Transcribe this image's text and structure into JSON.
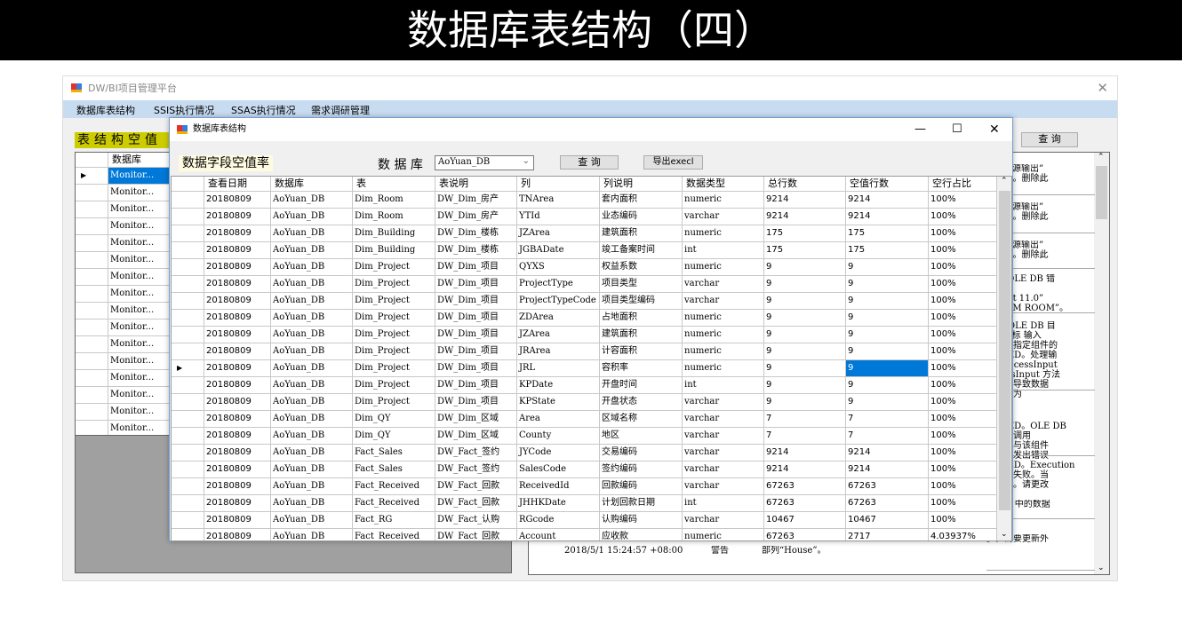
{
  "banner": {
    "title": "数据库表结构（四）"
  },
  "main_window": {
    "title": "DW/BI项目管理平台",
    "close_icon": "close-icon",
    "menu": [
      "数据库表结构",
      "SSIS执行情况",
      "SSAS执行情况",
      "需求调研管理"
    ]
  },
  "left_panel": {
    "label": "表结构空值",
    "header": "数据库",
    "rows": [
      "Monitor...",
      "Monitor...",
      "Monitor...",
      "Monitor...",
      "Monitor...",
      "Monitor...",
      "Monitor...",
      "Monitor...",
      "Monitor...",
      "Monitor...",
      "Monitor...",
      "Monitor...",
      "Monitor...",
      "Monitor...",
      "Monitor...",
      "Monitor..."
    ]
  },
  "right_panel": {
    "query_label": "查 询",
    "messages": [
      "E DB 源输出”\n)”(18)。删除此",
      "E DB 源输出”\n)”(18)。删除此",
      "E DB 源输出”\n)”(18)。删除此",
      "出现 OLE DB 错\n\n Client 11.0”\nPK DIM ROOM”。",
      "输入[OLE DB 目\nDB 目标 输入\n败。存指定组件的\nFAILED。处理输\n的 ProcessInput\nrocessInput 方法\n的，将导致数据\n误代码为",
      "FAILED。OLE DB\n道引擎调用\n代码只与该组件\n前已经发出错误\nACHED。Execution\n此导致失败。当\n种情况。请更改",
      "ouse” 中的数据\n。",
      "步。需要更新外"
    ],
    "log_time": "2018/5/1 15:24:57 +08:00",
    "log_level": "警告",
    "log_message": "部列“House”。"
  },
  "dialog": {
    "title": "数据库表结构",
    "heading": "数据字段空值率",
    "db_label": "数 据 库",
    "db_value": "AoYuan_DB",
    "query_label": "查 询",
    "export_label": "导出execl",
    "columns": [
      "查看日期",
      "数据库",
      "表",
      "表说明",
      "列",
      "列说明",
      "数据类型",
      "总行数",
      "空值行数",
      "空行占比"
    ],
    "selected_row": 10,
    "selected_col": 8,
    "accent": "#0078d7",
    "rows": [
      [
        "20180809",
        "AoYuan_DB",
        "Dim_Room",
        "DW_Dim_房产",
        "TNArea",
        "套内面积",
        "numeric",
        "9214",
        "9214",
        "100%"
      ],
      [
        "20180809",
        "AoYuan_DB",
        "Dim_Room",
        "DW_Dim_房产",
        "YTId",
        "业态编码",
        "varchar",
        "9214",
        "9214",
        "100%"
      ],
      [
        "20180809",
        "AoYuan_DB",
        "Dim_Building",
        "DW_Dim_楼栋",
        "JZArea",
        "建筑面积",
        "numeric",
        "175",
        "175",
        "100%"
      ],
      [
        "20180809",
        "AoYuan_DB",
        "Dim_Building",
        "DW_Dim_楼栋",
        "JGBADate",
        "竣工备案时间",
        "int",
        "175",
        "175",
        "100%"
      ],
      [
        "20180809",
        "AoYuan_DB",
        "Dim_Project",
        "DW_Dim_项目",
        "QYXS",
        "权益系数",
        "numeric",
        "9",
        "9",
        "100%"
      ],
      [
        "20180809",
        "AoYuan_DB",
        "Dim_Project",
        "DW_Dim_项目",
        "ProjectType",
        "项目类型",
        "varchar",
        "9",
        "9",
        "100%"
      ],
      [
        "20180809",
        "AoYuan_DB",
        "Dim_Project",
        "DW_Dim_项目",
        "ProjectTypeCode",
        "项目类型编码",
        "varchar",
        "9",
        "9",
        "100%"
      ],
      [
        "20180809",
        "AoYuan_DB",
        "Dim_Project",
        "DW_Dim_项目",
        "ZDArea",
        "占地面积",
        "numeric",
        "9",
        "9",
        "100%"
      ],
      [
        "20180809",
        "AoYuan_DB",
        "Dim_Project",
        "DW_Dim_项目",
        "JZArea",
        "建筑面积",
        "numeric",
        "9",
        "9",
        "100%"
      ],
      [
        "20180809",
        "AoYuan_DB",
        "Dim_Project",
        "DW_Dim_项目",
        "JRArea",
        "计容面积",
        "numeric",
        "9",
        "9",
        "100%"
      ],
      [
        "20180809",
        "AoYuan_DB",
        "Dim_Project",
        "DW_Dim_项目",
        "JRL",
        "容积率",
        "numeric",
        "9",
        "9",
        "100%"
      ],
      [
        "20180809",
        "AoYuan_DB",
        "Dim_Project",
        "DW_Dim_项目",
        "KPDate",
        "开盘时间",
        "int",
        "9",
        "9",
        "100%"
      ],
      [
        "20180809",
        "AoYuan_DB",
        "Dim_Project",
        "DW_Dim_项目",
        "KPState",
        "开盘状态",
        "varchar",
        "9",
        "9",
        "100%"
      ],
      [
        "20180809",
        "AoYuan_DB",
        "Dim_QY",
        "DW_Dim_区域",
        "Area",
        "区域名称",
        "varchar",
        "7",
        "7",
        "100%"
      ],
      [
        "20180809",
        "AoYuan_DB",
        "Dim_QY",
        "DW_Dim_区域",
        "County",
        "地区",
        "varchar",
        "7",
        "7",
        "100%"
      ],
      [
        "20180809",
        "AoYuan_DB",
        "Fact_Sales",
        "DW_Fact_签约",
        "JYCode",
        "交易编码",
        "varchar",
        "9214",
        "9214",
        "100%"
      ],
      [
        "20180809",
        "AoYuan_DB",
        "Fact_Sales",
        "DW_Fact_签约",
        "SalesCode",
        "签约编码",
        "varchar",
        "9214",
        "9214",
        "100%"
      ],
      [
        "20180809",
        "AoYuan_DB",
        "Fact_Received",
        "DW_Fact_回款",
        "ReceivedId",
        "回款编码",
        "varchar",
        "67263",
        "67263",
        "100%"
      ],
      [
        "20180809",
        "AoYuan_DB",
        "Fact_Received",
        "DW_Fact_回款",
        "JHHKDate",
        "计划回款日期",
        "int",
        "67263",
        "67263",
        "100%"
      ],
      [
        "20180809",
        "AoYuan_DB",
        "Fact_RG",
        "DW_Fact_认购",
        "RGcode",
        "认购编码",
        "varchar",
        "10467",
        "10467",
        "100%"
      ],
      [
        "20180809",
        "AoYuan_DB",
        "Fact_Received",
        "DW_Fact_回款",
        "Account",
        "应收款",
        "numeric",
        "67263",
        "2717",
        "4.03937%"
      ]
    ]
  }
}
